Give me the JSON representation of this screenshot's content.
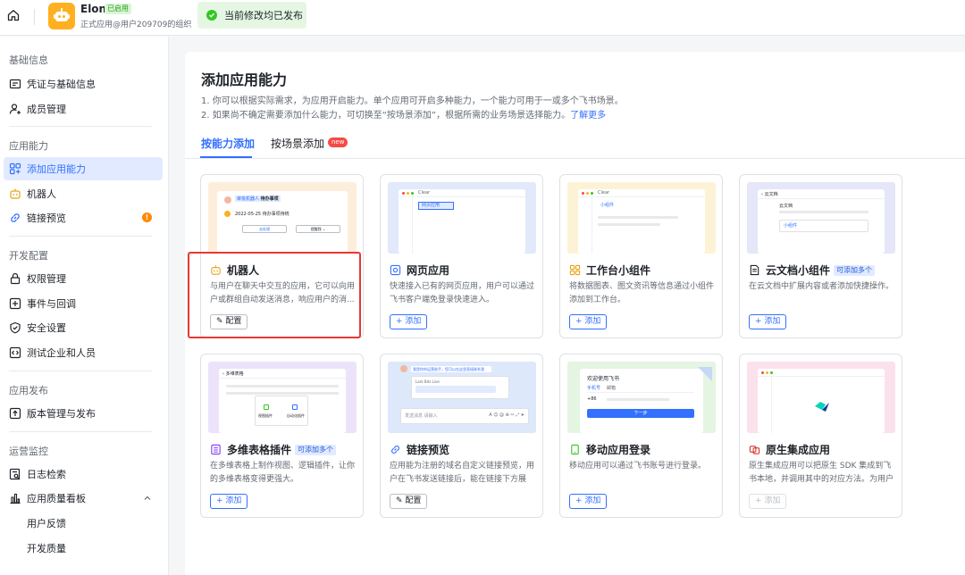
{
  "app": {
    "name": "Elon",
    "status": "已启用",
    "subtitle": "正式应用@用户209709的组织",
    "publish_banner": "当前修改均已发布"
  },
  "sidebar": {
    "sections": [
      {
        "label": "基础信息"
      },
      {
        "label": "应用能力"
      },
      {
        "label": "开发配置"
      },
      {
        "label": "应用发布"
      },
      {
        "label": "运营监控"
      }
    ],
    "items": [
      {
        "label": "凭证与基础信息",
        "icon": "credential-icon"
      },
      {
        "label": "成员管理",
        "icon": "user-add-icon"
      },
      {
        "label": "添加应用能力",
        "icon": "add-app-icon",
        "active": true
      },
      {
        "label": "机器人",
        "icon": "robot-icon"
      },
      {
        "label": "链接预览",
        "icon": "link-icon",
        "badge": "!"
      },
      {
        "label": "权限管理",
        "icon": "lock-icon"
      },
      {
        "label": "事件与回调",
        "icon": "event-icon"
      },
      {
        "label": "安全设置",
        "icon": "shield-icon"
      },
      {
        "label": "测试企业和人员",
        "icon": "code-icon"
      },
      {
        "label": "版本管理与发布",
        "icon": "upload-icon"
      },
      {
        "label": "日志检索",
        "icon": "log-search-icon"
      },
      {
        "label": "应用质量看板",
        "icon": "bar-chart-icon"
      },
      {
        "label": "用户反馈"
      },
      {
        "label": "开发质量"
      }
    ]
  },
  "main": {
    "title": "添加应用能力",
    "desc_line1": "1. 你可以根据实际需求，为应用开启能力。单个应用可开启多种能力，一个能力可用于一或多个飞书场景。",
    "desc_line2": "2. 如果尚不确定需要添加什么能力，可切换至“按场景添加”，根据所需的业务场景选择能力。",
    "learn_more": "了解更多",
    "tabs": [
      {
        "label": "按能力添加",
        "active": true
      },
      {
        "label": "按场景添加",
        "badge": "new"
      }
    ],
    "cards": [
      {
        "title": "机器人",
        "icon": "robot-icon",
        "desc": "与用户在聊天中交互的应用，它可以向用户或群组自动发送消息，响应用户的消...",
        "button": "配置",
        "button_type": "configure",
        "highlighted": true,
        "thumb": {
          "chip": "待办事项",
          "chip_prefix": "审批机器人",
          "line": "2022-05-25 待办事项待统",
          "btn1": "去处理",
          "btn2": "提醒我 ⌄"
        }
      },
      {
        "title": "网页应用",
        "icon": "web-app-icon",
        "desc": "快速接入已有的网页应用，用户可以通过飞书客户端免登录快速进入。",
        "button": "+ 添加",
        "button_type": "add",
        "thumb": {
          "tab": "Clear",
          "label": "网页应用"
        }
      },
      {
        "title": "工作台小组件",
        "icon": "widget-icon",
        "desc": "将数据图表、图文资讯等信息通过小组件添加到工作台。",
        "button": "+ 添加",
        "button_type": "add",
        "thumb": {
          "tab": "Clear",
          "label": "小组件"
        }
      },
      {
        "title": "云文档小组件",
        "icon": "doc-icon",
        "tag": "可添加多个",
        "desc": "在云文档中扩展内容或者添加快捷操作。",
        "button": "+ 添加",
        "button_type": "add",
        "thumb": {
          "header": "云文档",
          "line": "云文档",
          "label": "小组件"
        }
      },
      {
        "title": "多维表格插件",
        "icon": "table-icon",
        "tag": "可添加多个",
        "desc": "在多维表格上制作视图、逻辑插件，让你的多维表格变得更强大。",
        "button": "+ 添加",
        "button_type": "add",
        "thumb": {
          "header": "多维表格",
          "plugin1": "视图插件",
          "plugin2": "自动化插件"
        }
      },
      {
        "title": "链接预览",
        "icon": "link-icon",
        "desc": "应用能为注册的域名自定义链接预览，用户在飞书发送链接后，能在链接下方展示...",
        "button": "配置",
        "button_type": "configure",
        "thumb": {
          "bubble": "我是你的运营助手，您可以在这里直接联系我",
          "link": "Lark Bits Live",
          "placeholder": "发送消息 请输入"
        }
      },
      {
        "title": "移动应用登录",
        "icon": "mobile-icon",
        "desc": "移动应用可以通过飞书账号进行登录。",
        "button": "+ 添加",
        "button_type": "add",
        "thumb": {
          "welcome": "欢迎使用飞书",
          "tab1": "手机号",
          "tab2": "邮箱",
          "code": "+86",
          "next": "下一步"
        }
      },
      {
        "title": "原生集成应用",
        "icon": "native-app-icon",
        "desc": "原生集成应用可以把原生 SDK 集成到飞书本地，并调用其中的对应方法。为用户提...",
        "button": "+ 添加",
        "button_type": "disabled",
        "thumb": {}
      }
    ]
  },
  "colors": {
    "accent": "#3370ff",
    "highlight": "#e53935",
    "success": "#34c724",
    "badge": "#ff8800"
  }
}
